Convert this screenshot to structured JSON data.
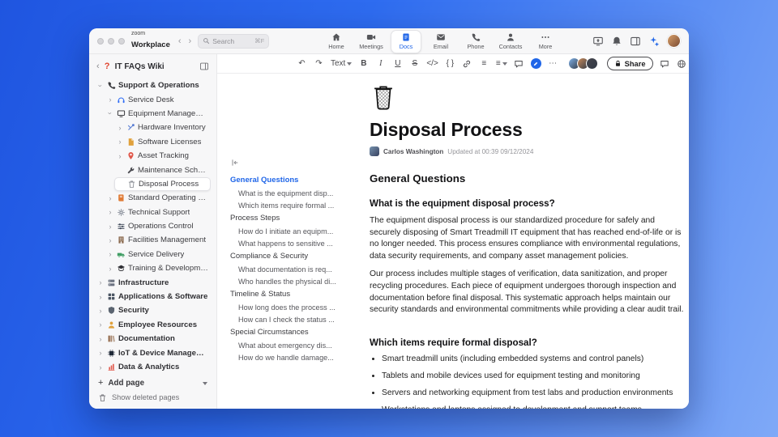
{
  "accent_color": "#2066e8",
  "titlebar": {
    "brand": {
      "top": "zoom",
      "bottom": "Workplace"
    },
    "search": {
      "placeholder": "Search",
      "shortcut": "⌘F"
    },
    "tabs": [
      {
        "label": "Home",
        "icon": "home-icon",
        "active": false
      },
      {
        "label": "Meetings",
        "icon": "video-icon",
        "active": false
      },
      {
        "label": "Docs",
        "icon": "docs-icon",
        "active": true
      },
      {
        "label": "Email",
        "icon": "mail-icon",
        "active": false
      },
      {
        "label": "Phone",
        "icon": "phone-icon",
        "active": false
      },
      {
        "label": "Contacts",
        "icon": "person-icon",
        "active": false
      },
      {
        "label": "More",
        "icon": "more-icon",
        "active": false
      }
    ],
    "right_icons": [
      {
        "name": "screenshare-icon"
      },
      {
        "name": "bell-icon"
      },
      {
        "name": "panel-icon"
      },
      {
        "name": "sparkle-plus-icon",
        "accent": true
      }
    ]
  },
  "sidebar": {
    "title": "IT FAQs Wiki",
    "items": [
      {
        "label": "Support & Operations",
        "icon": "phone-icon",
        "color": "#3a3a3e",
        "level": 0,
        "chevron": "expanded"
      },
      {
        "label": "Service Desk",
        "icon": "headset-icon",
        "color": "#2f6df6",
        "level": 1,
        "chevron": "collapsed"
      },
      {
        "label": "Equipment Management",
        "icon": "monitor-icon",
        "color": "#2b2b2f",
        "level": 1,
        "chevron": "expanded"
      },
      {
        "label": "Hardware Inventory",
        "icon": "tools-icon",
        "color": "#5b7fd4",
        "level": 2,
        "chevron": "collapsed"
      },
      {
        "label": "Software Licenses",
        "icon": "license-icon",
        "color": "#e0a13c",
        "level": 2,
        "chevron": "collapsed"
      },
      {
        "label": "Asset Tracking",
        "icon": "pin-icon",
        "color": "#e0574a",
        "level": 2,
        "chevron": "collapsed"
      },
      {
        "label": "Maintenance Schedules",
        "icon": "wrench-icon",
        "color": "#4a4a50",
        "level": 2,
        "chevron": "none"
      },
      {
        "label": "Disposal Process",
        "icon": "trash-icon",
        "color": "#83878f",
        "level": 2,
        "chevron": "none",
        "selected": true
      },
      {
        "label": "Standard Operating Procedures",
        "icon": "book-icon",
        "color": "#e07b35",
        "level": 1,
        "chevron": "collapsed"
      },
      {
        "label": "Technical Support",
        "icon": "gear-icon",
        "color": "#6b7280",
        "level": 1,
        "chevron": "collapsed"
      },
      {
        "label": "Operations Control",
        "icon": "sliders-icon",
        "color": "#374151",
        "level": 1,
        "chevron": "collapsed"
      },
      {
        "label": "Facilities Management",
        "icon": "building-icon",
        "color": "#8a6a4f",
        "level": 1,
        "chevron": "collapsed"
      },
      {
        "label": "Service Delivery",
        "icon": "truck-icon",
        "color": "#3f9d63",
        "level": 1,
        "chevron": "collapsed"
      },
      {
        "label": "Training & Development",
        "icon": "cap-icon",
        "color": "#2e2e33",
        "level": 1,
        "chevron": "collapsed"
      },
      {
        "label": "Infrastructure",
        "icon": "server-icon",
        "color": "#6b7280",
        "level": 0,
        "chevron": "collapsed"
      },
      {
        "label": "Applications & Software",
        "icon": "apps-icon",
        "color": "#4b5563",
        "level": 0,
        "chevron": "collapsed"
      },
      {
        "label": "Security",
        "icon": "shield-icon",
        "color": "#5b6470",
        "level": 0,
        "chevron": "collapsed"
      },
      {
        "label": "Employee Resources",
        "icon": "person-icon",
        "color": "#e0a13c",
        "level": 0,
        "chevron": "collapsed"
      },
      {
        "label": "Documentation",
        "icon": "books-icon",
        "color": "#8b5e3c",
        "level": 0,
        "chevron": "collapsed"
      },
      {
        "label": "IoT & Device Management",
        "icon": "chip-icon",
        "color": "#1f2937",
        "level": 0,
        "chevron": "collapsed"
      },
      {
        "label": "Data & Analytics",
        "icon": "chart-icon",
        "color": "#e0574a",
        "level": 0,
        "chevron": "collapsed"
      }
    ],
    "footer": {
      "add_label": "Add page",
      "deleted_label": "Show deleted pages"
    }
  },
  "doc_toolbar": {
    "buttons": [
      {
        "name": "undo-button",
        "glyph": "↶"
      },
      {
        "name": "redo-button",
        "glyph": "↷"
      },
      {
        "name": "text-style-select",
        "glyph": "Text",
        "chevron": true
      },
      {
        "name": "bold-button",
        "glyph": "B",
        "cls": "bold"
      },
      {
        "name": "italic-button",
        "glyph": "I",
        "cls": "italic"
      },
      {
        "name": "underline-button",
        "glyph": "U",
        "cls": "underline"
      },
      {
        "name": "strikethrough-button",
        "glyph": "S",
        "cls": "strike"
      },
      {
        "name": "inline-code-button",
        "glyph": "</>"
      },
      {
        "name": "code-block-button",
        "glyph": "{ }"
      },
      {
        "name": "link-button",
        "icon": "link-icon"
      },
      {
        "name": "bullet-list-button",
        "glyph": "≡"
      },
      {
        "name": "align-button",
        "glyph": "≡",
        "chevron": true
      },
      {
        "name": "comment-button",
        "icon": "comment-icon"
      },
      {
        "name": "ai-companion-button",
        "icon": "pen-icon",
        "accent": true
      },
      {
        "name": "more-formatting-button",
        "glyph": "⋯"
      }
    ],
    "collaborator_colors": [
      "#7fb1e8",
      "#c98a5a",
      "#44444c"
    ],
    "share_label": "Share",
    "right_buttons": [
      {
        "name": "comments-button",
        "icon": "comment-icon"
      },
      {
        "name": "publish-to-web-button",
        "icon": "globe-icon"
      },
      {
        "name": "more-options-button",
        "glyph": "⋯"
      }
    ]
  },
  "toc": {
    "sections": [
      {
        "label": "General Questions",
        "active": true,
        "children": [
          "What is the equipment disp...",
          "Which items require formal ..."
        ]
      },
      {
        "label": "Process Steps",
        "active": false,
        "children": [
          "How do I initiate an equipm...",
          "What happens to sensitive ..."
        ]
      },
      {
        "label": "Compliance & Security",
        "active": false,
        "children": [
          "What documentation is req...",
          "Who handles the physical di..."
        ]
      },
      {
        "label": "Timeline & Status",
        "active": false,
        "children": [
          "How long does the process ...",
          "How can I check the status ..."
        ]
      },
      {
        "label": "Special Circumstances",
        "active": false,
        "children": [
          "What about emergency dis...",
          "How do we handle damage..."
        ]
      }
    ]
  },
  "document": {
    "icon": "trash-doc-icon",
    "title": "Disposal Process",
    "author": "Carlos Washington",
    "updated_text": "Updated at 00:39 09/12/2024",
    "body": [
      {
        "type": "h2",
        "text": "General Questions"
      },
      {
        "type": "h3",
        "text": "What is the equipment disposal process?"
      },
      {
        "type": "p",
        "text": "The equipment disposal process is our standardized procedure for safely and securely disposing of Smart Treadmill IT equipment that has reached end-of-life or is no longer needed. This process ensures compliance with environmental regulations, data security requirements, and company asset management policies."
      },
      {
        "type": "p",
        "text": "Our process includes multiple stages of verification, data sanitization, and proper recycling procedures. Each piece of equipment undergoes thorough inspection and documentation before final disposal. This systematic approach helps maintain our security standards and environmental commitments while providing a clear audit trail."
      },
      {
        "type": "h3",
        "text": "Which items require formal disposal?",
        "gap": true
      },
      {
        "type": "ul",
        "items": [
          "Smart treadmill units (including embedded systems and control panels)",
          "Tablets and mobile devices used for equipment testing and monitoring",
          "Servers and networking equipment from test labs and production environments",
          "Workstations and laptops assigned to development and support teams"
        ]
      }
    ]
  }
}
